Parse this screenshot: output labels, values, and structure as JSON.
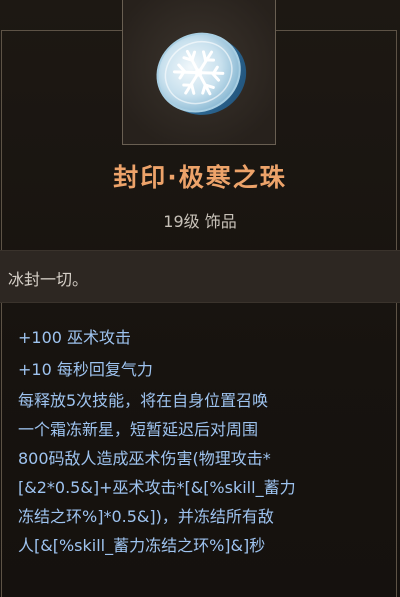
{
  "item": {
    "name": "封印·极寒之珠",
    "meta": "19级 饰品",
    "flavor": "冰封一切。",
    "icon": "frost-coin-snowflake-icon",
    "name_color": "#eda36a",
    "stat_color": "#9ec3ef"
  },
  "stats": [
    "+100 巫术攻击",
    "+10 每秒回复气力"
  ],
  "description_lines": [
    "每释放5次技能，将在自身位置召唤",
    "一个霜冻新星，短暂延迟后对周围",
    "800码敌人造成巫术伤害(物理攻击*",
    "[&2*0.5&]+巫术攻击*[&[%skill_蓄力",
    "冻结之环%]*0.5&])，并冻结所有敌",
    "人[&[%skill_蓄力冻结之环%]&]秒"
  ]
}
